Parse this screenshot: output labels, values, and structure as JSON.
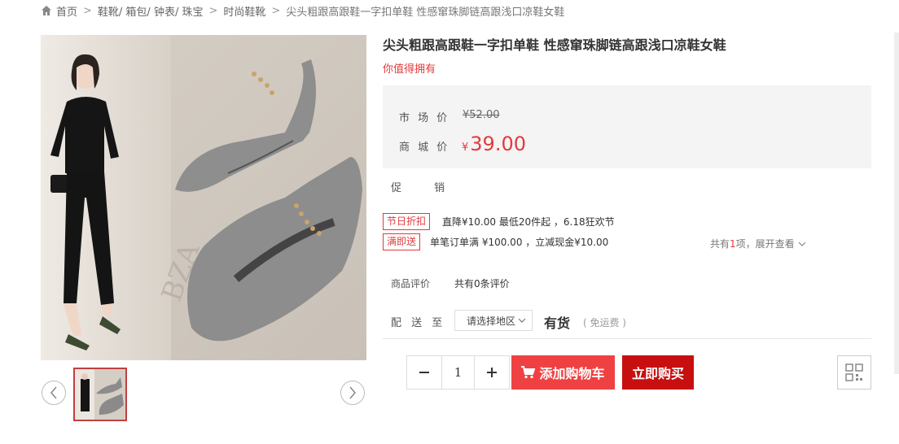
{
  "breadcrumb": {
    "home": "首页",
    "category": "鞋靴/ 箱包/ 钟表/ 珠宝",
    "subcategory": "时尚鞋靴",
    "current": "尖头粗跟高跟鞋一字扣单鞋 性感窜珠脚链高跟浅口凉鞋女鞋"
  },
  "product": {
    "title": "尖头粗跟高跟鞋一字扣单鞋 性感窜珠脚链高跟浅口凉鞋女鞋",
    "subtitle": "你值得拥有"
  },
  "price": {
    "market_label": "市 场 价",
    "market_value": "¥52.00",
    "mall_label": "商 城 价",
    "currency": "¥",
    "mall_value": "39.00"
  },
  "promotions": {
    "label": "促 销",
    "items": [
      {
        "tag": "节日折扣",
        "text": "直降¥10.00 最低20件起 ，6.18狂欢节"
      },
      {
        "tag": "满即送",
        "text": "单笔订单满 ¥100.00 ，立减现金¥10.00"
      }
    ],
    "toggle_prefix": "共有",
    "toggle_count": "1",
    "toggle_suffix": "项，展开查看"
  },
  "reviews": {
    "label": "商品评价",
    "text": "共有0条评价"
  },
  "shipping": {
    "label": "配 送 至",
    "region_placeholder": "请选择地区",
    "stock": "有货",
    "free_shipping": "( 免运费 )"
  },
  "purchase": {
    "quantity": "1",
    "minus": "−",
    "plus": "+",
    "add_to_cart": "添加购物车",
    "buy_now": "立即购买"
  },
  "colors": {
    "accent": "#e4393c",
    "cart": "#f04142",
    "buy": "#c80f10"
  },
  "icons": {
    "home": "home-icon",
    "prev": "chevron-left-icon",
    "next": "chevron-right-icon",
    "cart": "cart-icon",
    "qr": "qr-code-icon"
  }
}
